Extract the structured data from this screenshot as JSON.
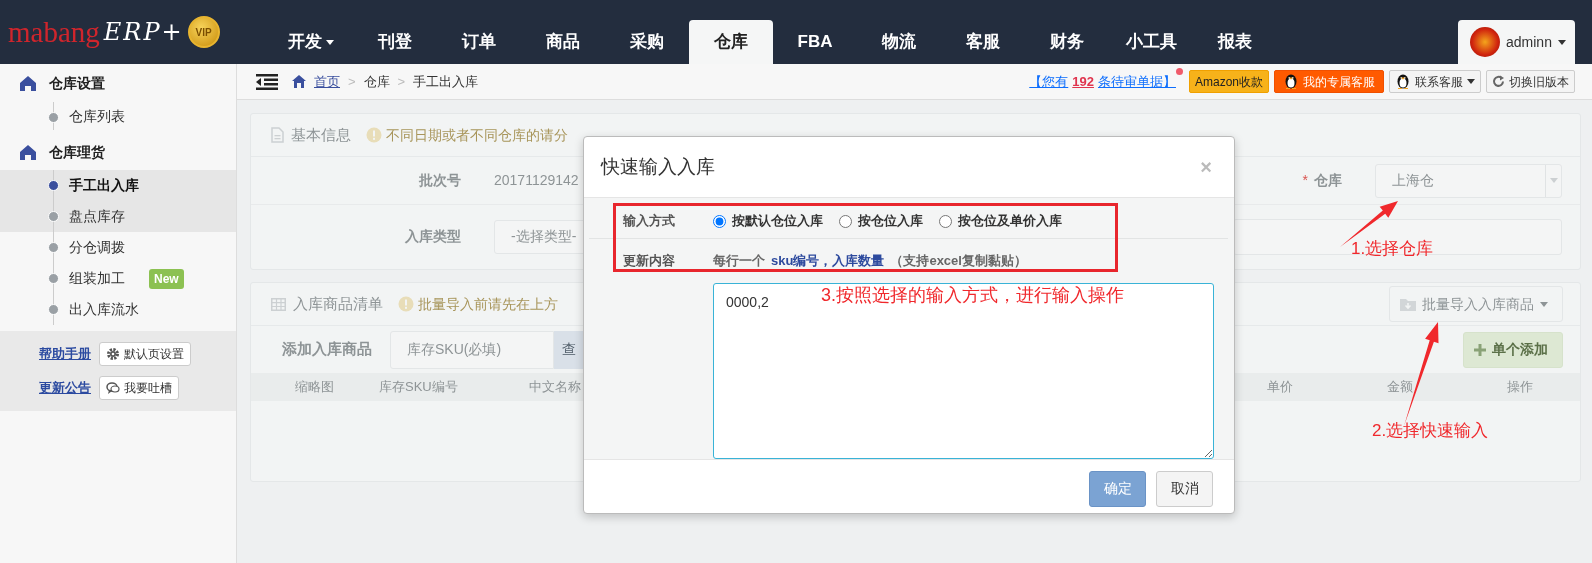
{
  "logo": {
    "brand": "mabang",
    "product": "ERP+",
    "badge": "VIP"
  },
  "nav_tabs": [
    {
      "label": "开发",
      "dropdown": true,
      "selected": false
    },
    {
      "label": "刊登",
      "dropdown": false,
      "selected": false
    },
    {
      "label": "订单",
      "dropdown": false,
      "selected": false
    },
    {
      "label": "商品",
      "dropdown": false,
      "selected": false
    },
    {
      "label": "采购",
      "dropdown": false,
      "selected": false
    },
    {
      "label": "仓库",
      "dropdown": false,
      "selected": true
    },
    {
      "label": "FBA",
      "dropdown": false,
      "selected": false
    },
    {
      "label": "物流",
      "dropdown": false,
      "selected": false
    },
    {
      "label": "客服",
      "dropdown": false,
      "selected": false
    },
    {
      "label": "财务",
      "dropdown": false,
      "selected": false
    },
    {
      "label": "小工具",
      "dropdown": false,
      "selected": false
    },
    {
      "label": "报表",
      "dropdown": false,
      "selected": false
    }
  ],
  "user_menu": {
    "name": "adminn"
  },
  "sidebar": {
    "groups": [
      {
        "title": "仓库设置",
        "items": [
          {
            "label": "仓库列表",
            "selected": false,
            "hovered": false
          }
        ]
      },
      {
        "title": "仓库理货",
        "items": [
          {
            "label": "手工出入库",
            "selected": true,
            "hovered": false
          },
          {
            "label": "盘点库存",
            "selected": false,
            "hovered": true
          },
          {
            "label": "分仓调拨",
            "selected": false,
            "hovered": false
          },
          {
            "label": "组装加工",
            "badge": "New",
            "selected": false,
            "hovered": false
          },
          {
            "label": "出入库流水",
            "selected": false,
            "hovered": false
          }
        ]
      }
    ],
    "footer": [
      {
        "link": "帮助手册",
        "button": "默认页设置",
        "kind": "gear"
      },
      {
        "link": "更新公告",
        "button": "我要吐槽",
        "kind": "chat"
      }
    ]
  },
  "breadcrumb": {
    "separator": ">",
    "items": [
      "首页",
      "仓库",
      "手工出入库"
    ]
  },
  "notice": {
    "prefix": "【您有",
    "count": "192",
    "suffix": "条待审单据】",
    "unread": true
  },
  "toolbar": [
    {
      "label": "Amazon收款",
      "kind": "amazon"
    },
    {
      "label": "我的专属客服",
      "kind": "service"
    },
    {
      "label": "联系客服",
      "kind": "contact"
    },
    {
      "label": "切换旧版本",
      "kind": "switch"
    }
  ],
  "basic_panel": {
    "title": "基本信息",
    "warning": "不同日期或者不同仓库的请分",
    "batch_label": "批次号",
    "batch_value": "20171129142",
    "type_label": "入库类型",
    "type_placeholder": "-选择类型-",
    "warehouse_label": "仓库",
    "warehouse_required": "*",
    "warehouse_value": "上海仓"
  },
  "goods_panel": {
    "title": "入库商品清单",
    "warning": "批量导入前请先在上方",
    "import_button": "批量导入入库商品",
    "add_label": "添加入库商品",
    "sku_placeholder": "库存SKU(必填)",
    "search_button": "查",
    "add_button": "单个添加",
    "columns": [
      "缩略图",
      "库存SKU编号",
      "中文名称",
      "单价",
      "金额",
      "操作"
    ]
  },
  "modal": {
    "title": "快速输入入库",
    "close": "×",
    "method_label": "输入方式",
    "methods": [
      {
        "label": "按默认仓位入库",
        "selected": true
      },
      {
        "label": "按仓位入库",
        "selected": false
      },
      {
        "label": "按仓位及单价入库",
        "selected": false
      }
    ],
    "content_label": "更新内容",
    "hint_prefix": "每行一个",
    "hint_fields": "sku编号，入库数量",
    "hint_suffix": "（支持excel复制黏贴）",
    "text_value": "0000,2",
    "confirm": "确定",
    "cancel": "取消"
  },
  "annotations": [
    "1.选择仓库",
    "2.选择快速输入",
    "3.按照选择的输入方式，进行输入操作"
  ]
}
